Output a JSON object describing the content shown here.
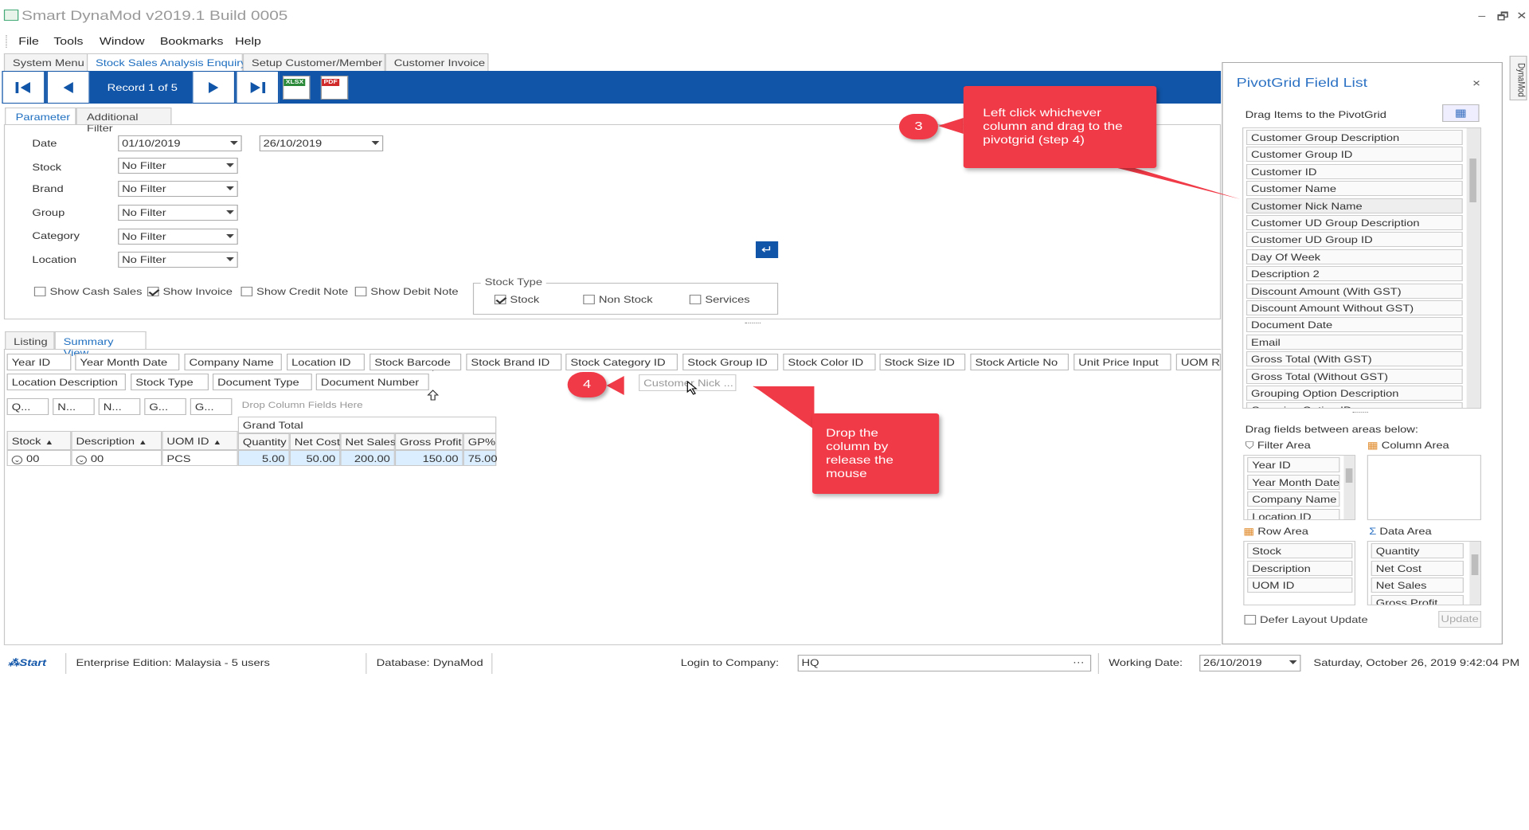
{
  "window": {
    "title": "Smart DynaMod v2019.1 Build 0005",
    "minimize": "–",
    "restore": "🗗",
    "close": "✕"
  },
  "menu": [
    "File",
    "Tools",
    "Window",
    "Bookmarks",
    "Help"
  ],
  "doc_tabs": [
    "System Menu",
    "Stock Sales Analysis Enquiry",
    "Setup Customer/Member",
    "Customer Invoice"
  ],
  "nav": {
    "record": "Record 1 of 5",
    "xlsx": "XLSX",
    "pdf": "PDF"
  },
  "param_tabs": [
    "Parameter",
    "Additional Filter"
  ],
  "params": {
    "date_label": "Date",
    "date_from": "01/10/2019",
    "date_to": "26/10/2019",
    "stock_label": "Stock",
    "stock_value": "No Filter",
    "brand_label": "Brand",
    "brand_value": "No Filter",
    "group_label": "Group",
    "group_value": "No Filter",
    "category_label": "Category",
    "category_value": "No Filter",
    "location_label": "Location",
    "location_value": "No Filter"
  },
  "doc_checks": [
    {
      "label": "Show Cash Sales",
      "checked": false
    },
    {
      "label": "Show Invoice",
      "checked": true
    },
    {
      "label": "Show Credit Note",
      "checked": false
    },
    {
      "label": "Show Debit Note",
      "checked": false
    }
  ],
  "stock_type": {
    "title": "Stock Type",
    "stock": "Stock",
    "non_stock": "Non Stock",
    "services": "Services"
  },
  "lower_tabs": [
    "Listing",
    "Summary View"
  ],
  "filter_fields_row1": [
    "Year ID",
    "Year Month Date",
    "Company Name",
    "Location ID",
    "Stock Barcode",
    "Stock Brand ID",
    "Stock Category ID",
    "Stock Group ID",
    "Stock Color ID",
    "Stock Size ID",
    "Stock Article No",
    "Unit Price Input",
    "UOM Ra"
  ],
  "filter_fields_row2": [
    "Location Description",
    "Stock Type",
    "Document Type",
    "Document Number"
  ],
  "dragging_field": "Customer Nick ...",
  "data_fields": [
    "Q...",
    "N...",
    "N...",
    "G...",
    "G..."
  ],
  "drop_hint": "Drop Column Fields Here",
  "pivot": {
    "row_headers": [
      "Stock",
      "Description",
      "UOM ID"
    ],
    "grand_total": "Grand Total",
    "data_headers": [
      "Quantity",
      "Net Cost",
      "Net Sales",
      "Gross Profit",
      "GP%"
    ],
    "row": {
      "stock": "00",
      "description": "00",
      "uom": "PCS",
      "values": [
        "5.00",
        "50.00",
        "200.00",
        "150.00",
        "75.00"
      ]
    }
  },
  "field_list": {
    "title": "PivotGrid Field List",
    "close": "×",
    "drag_label": "Drag Items to the PivotGrid",
    "items": [
      "Customer Group Description",
      "Customer Group ID",
      "Customer ID",
      "Customer Name",
      "Customer Nick Name",
      "Customer UD Group Description",
      "Customer UD Group ID",
      "Day Of Week",
      "Description 2",
      "Discount Amount (With GST)",
      "Discount Amount Without GST)",
      "Document Date",
      "Email",
      "Gross Total (With GST)",
      "Gross Total (Without GST)",
      "Grouping Option Description",
      "Grouping Option ID"
    ],
    "between_label": "Drag fields between areas below:",
    "filter_area": "Filter Area",
    "column_area": "Column Area",
    "row_area": "Row Area",
    "data_area": "Data Area",
    "filter_items": [
      "Year ID",
      "Year Month Date",
      "Company Name",
      "Location ID"
    ],
    "row_items": [
      "Stock",
      "Description",
      "UOM ID"
    ],
    "data_items": [
      "Quantity",
      "Net Cost",
      "Net Sales",
      "Gross Profit"
    ],
    "defer": "Defer Layout Update",
    "update": "Update"
  },
  "side_tab": "DynaMod",
  "callouts": {
    "step3_badge": "3",
    "step3_text": "Left click whichever column and drag to the pivotgrid (step 4)",
    "step4_badge": "4",
    "step4_text": "Drop the column by release the mouse"
  },
  "status": {
    "start": "Start",
    "edition": "Enterprise Edition: Malaysia - 5 users",
    "database": "Database: DynaMod",
    "login_label": "Login to Company:",
    "company": "HQ",
    "ellipsis": "···",
    "working_label": "Working Date:",
    "working_date": "26/10/2019",
    "datetime": "Saturday, October 26, 2019 9:42:04 PM"
  },
  "colors": {
    "accent": "#1155a8",
    "callout": "#f03a47",
    "link": "#1f6fc0"
  }
}
